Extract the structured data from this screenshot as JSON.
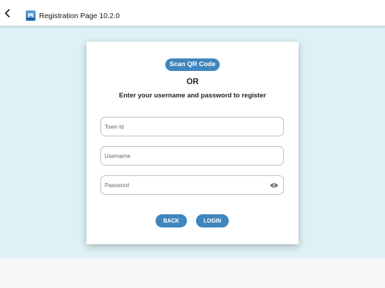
{
  "header": {
    "title": "Registration Page 10.2.0",
    "back_icon": "chevron-left-icon",
    "app_icon": "app-download-icon"
  },
  "form": {
    "scan_qr_label": "Scan QR Code",
    "or_label": "OR",
    "instruction": "Enter your username and password to register",
    "town_id_placeholder": "Town Id",
    "town_id_value": "",
    "username_placeholder": "Username",
    "username_value": "",
    "password_placeholder": "Password",
    "password_value": "",
    "password_toggle_icon": "eye-icon",
    "back_label": "BACK",
    "login_label": "LOGIN"
  },
  "colors": {
    "accent": "#3f86be",
    "page_background": "#def1f6",
    "card": "#ffffff"
  }
}
